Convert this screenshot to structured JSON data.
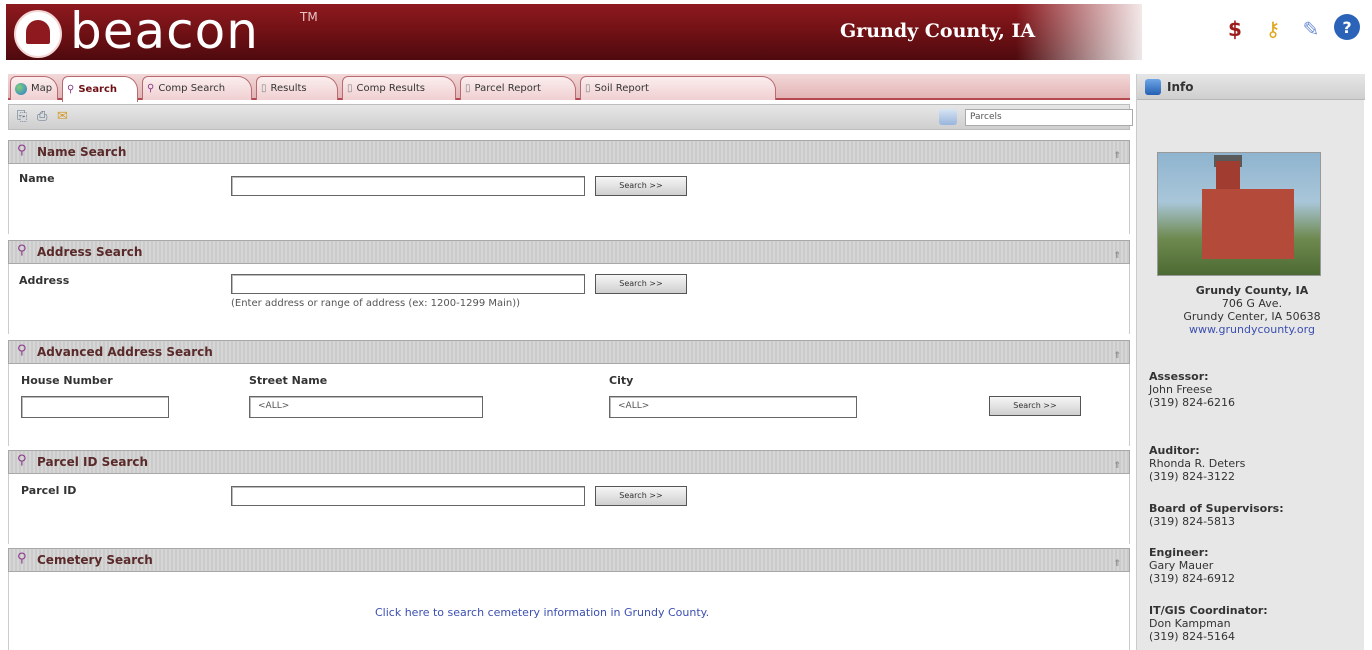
{
  "header": {
    "logo_text": "beacon",
    "logo_tm": "TM",
    "county_title": "Grundy County, IA",
    "icons": [
      "dollar-icon",
      "key-icon",
      "pencil-icon",
      "help-icon"
    ]
  },
  "tabs": [
    {
      "label": "Map",
      "icon": "globe-icon",
      "active": false
    },
    {
      "label": "Search",
      "icon": "search-icon",
      "active": true
    },
    {
      "label": "Comp Search",
      "icon": "search-icon",
      "active": false
    },
    {
      "label": "Results",
      "icon": "document-icon",
      "active": false
    },
    {
      "label": "Comp Results",
      "icon": "document-icon",
      "active": false
    },
    {
      "label": "Parcel Report",
      "icon": "document-icon",
      "active": false
    },
    {
      "label": "Soil Report",
      "icon": "document-icon",
      "active": false
    }
  ],
  "toolbar": {
    "layer_select": "Parcels",
    "icons": [
      "export-icon",
      "print-icon",
      "email-icon",
      "layers-icon"
    ]
  },
  "sections": {
    "name_search": {
      "title": "Name Search",
      "label": "Name",
      "input_value": "",
      "button": "Search >>"
    },
    "address_search": {
      "title": "Address Search",
      "label": "Address",
      "input_value": "",
      "hint": "(Enter address or range of address (ex: 1200-1299 Main))",
      "button": "Search >>"
    },
    "advanced_address_search": {
      "title": "Advanced Address Search",
      "house_number_label": "House Number",
      "street_name_label": "Street Name",
      "city_label": "City",
      "street_value": "<ALL>",
      "city_value": "<ALL>",
      "button": "Search >>"
    },
    "parcel_id_search": {
      "title": "Parcel ID Search",
      "label": "Parcel ID",
      "input_value": "",
      "button": "Search >>"
    },
    "cemetery_search": {
      "title": "Cemetery Search",
      "link": "Click here to search cemetery information in Grundy County."
    }
  },
  "info_panel": {
    "title": "Info",
    "county_name": "Grundy County, IA",
    "address_line1": "706 G Ave.",
    "address_line2": "Grundy Center, IA 50638",
    "website": "www.grundycounty.org",
    "contacts": [
      {
        "role": "Assessor:",
        "name": "John Freese",
        "phone": "(319) 824-6216"
      },
      {
        "role": "Auditor:",
        "name": "Rhonda R. Deters",
        "phone": "(319) 824-3122"
      },
      {
        "role": "Board of Supervisors:",
        "name": "",
        "phone": "(319) 824-5813"
      },
      {
        "role": "Engineer:",
        "name": "Gary Mauer",
        "phone": "(319) 824-6912"
      },
      {
        "role": "IT/GIS Coordinator:",
        "name": "Don Kampman",
        "phone": "(319) 824-5164"
      }
    ]
  },
  "colors": {
    "brand_maroon": "#6d1014",
    "link_blue": "#3b4fb0",
    "tab_pink": "#f0cfd1"
  }
}
